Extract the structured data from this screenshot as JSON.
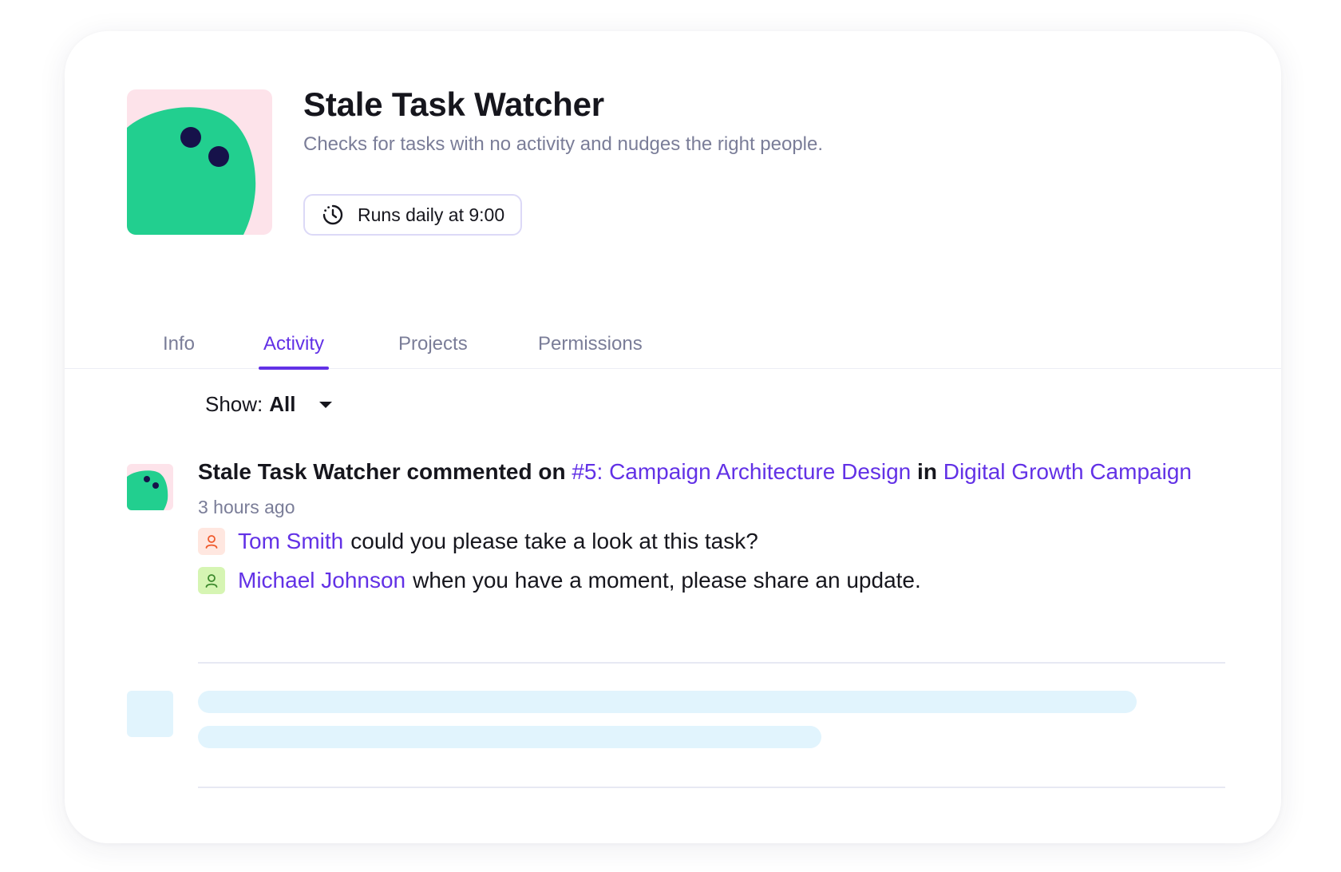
{
  "agent": {
    "name": "Stale Task Watcher",
    "description": "Checks for tasks with no activity and nudges the right people.",
    "schedule_label": "Runs daily at 9:00",
    "schedule_icon": "clock-icon"
  },
  "tabs": [
    {
      "label": "Info",
      "active": false
    },
    {
      "label": "Activity",
      "active": true
    },
    {
      "label": "Projects",
      "active": false
    },
    {
      "label": "Permissions",
      "active": false
    }
  ],
  "filter": {
    "label": "Show:",
    "value": "All",
    "icon": "caret-down-icon"
  },
  "activity": [
    {
      "actor": "Stale Task Watcher",
      "verb": "commented on",
      "task_link": "#5: Campaign Architecture Design",
      "preposition": "in",
      "project_link": "Digital Growth Campaign",
      "time": "3 hours ago",
      "mentions": [
        {
          "name": "Tom Smith",
          "text": "could you please take a look at this task?",
          "badge_color": "#ffe7e0",
          "icon_color": "#ef5a2c",
          "icon": "user-icon"
        },
        {
          "name": "Michael Johnson",
          "text": "when you have a moment, please share an update.",
          "badge_color": "#d6f5b3",
          "icon_color": "#3d8a2d",
          "icon": "user-icon"
        }
      ]
    }
  ],
  "colors": {
    "accent": "#6231e6",
    "avatar_bg": "#fde3ea",
    "avatar_body": "#22cf8f",
    "avatar_eyes": "#16124a",
    "skeleton": "#e1f4fd"
  }
}
